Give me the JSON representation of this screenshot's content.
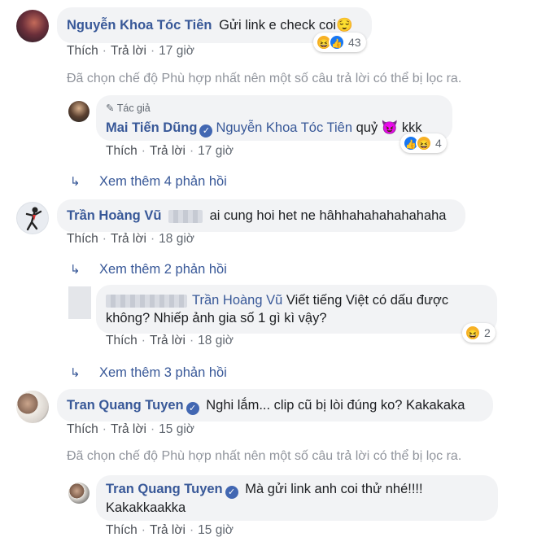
{
  "colors": {
    "link": "#385898",
    "bubble": "#f2f3f5",
    "meta": "#606770",
    "notice": "#90949c"
  },
  "actions": {
    "like": "Thích",
    "reply": "Trả lời",
    "sep": "·"
  },
  "notice": "Đã chọn chế độ Phù hợp nhất nên một số câu trả lời có thể bị lọc ra.",
  "comments": [
    {
      "name": "Nguyễn Khoa Tóc Tiên",
      "text": "Gửi link e check coi😌",
      "time": "17 giờ",
      "reactions": {
        "icons": [
          "haha-icon",
          "like-icon"
        ],
        "count": "43"
      },
      "replies": [
        {
          "author_tag": "Tác giả",
          "name": "Mai Tiến Dũng",
          "verified": true,
          "mention": "Nguyễn Khoa Tóc Tiên",
          "text": "quỷ 😈 kkk",
          "time": "17 giờ",
          "reactions": {
            "icons": [
              "like-icon",
              "haha-icon"
            ],
            "count": "4"
          }
        }
      ],
      "more_replies": "Xem thêm 4 phản hồi"
    },
    {
      "name": "Trần Hoàng Vũ",
      "text": "ai cung hoi het ne hâhhahahahahahaha",
      "time": "18 giờ",
      "more_replies": "Xem thêm 2 phản hồi",
      "replies": [
        {
          "mention": "Trần Hoàng Vũ",
          "text_line1": "Viết tiếng Việt có dấu được",
          "text_line2": "không? Nhiếp ảnh gia số 1 gì kì vậy?",
          "time": "18 giờ",
          "reactions": {
            "icons": [
              "haha-icon"
            ],
            "count": "2"
          }
        }
      ],
      "more_replies_2": "Xem thêm 3 phản hồi"
    },
    {
      "name": "Tran Quang Tuyen",
      "verified": true,
      "text": "Nghi lắm... clip cũ bị lòi đúng ko? Kakakaka",
      "time": "15 giờ",
      "replies": [
        {
          "name": "Tran Quang Tuyen",
          "verified": true,
          "text_line1": "Mà gửi link anh coi thử nhé!!!!",
          "text_line2": "Kakakkaakka",
          "time": "15 giờ"
        }
      ]
    }
  ]
}
